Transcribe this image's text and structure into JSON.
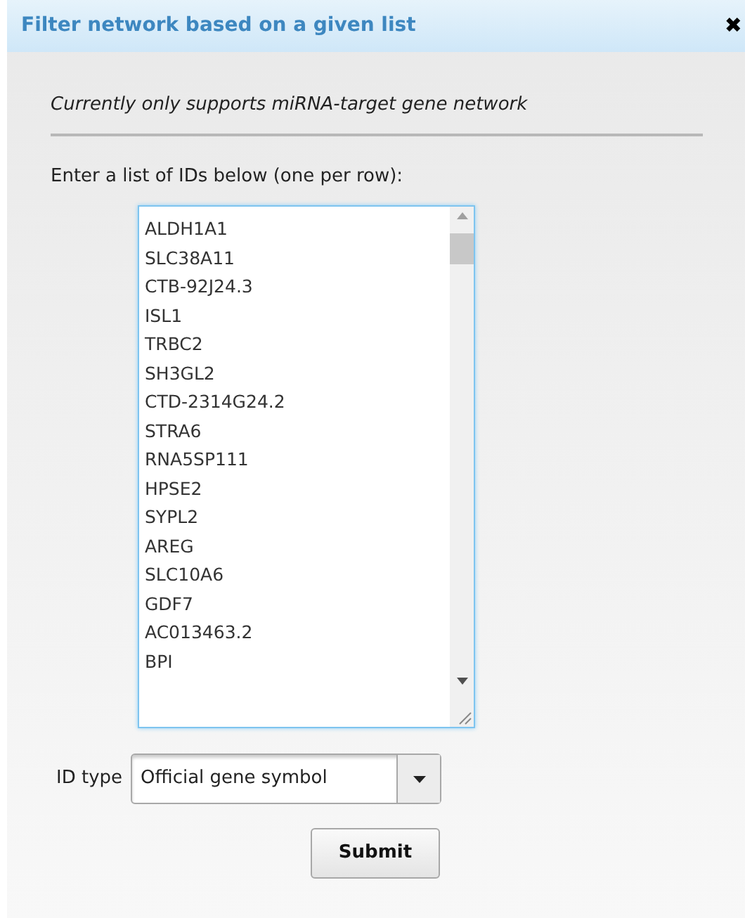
{
  "dialog": {
    "title": "Filter network based on a given list",
    "close": "✖"
  },
  "note": "Currently only supports miRNA-target gene network",
  "list_label": "Enter a list of IDs below (one per row):",
  "ids": [
    "ALDH1A1",
    "SLC38A11",
    "CTB-92J24.3",
    "ISL1",
    "TRBC2",
    "SH3GL2",
    "CTD-2314G24.2",
    "STRA6",
    "RNA5SP111",
    "HPSE2",
    "SYPL2",
    "AREG",
    "SLC10A6",
    "GDF7",
    "AC013463.2",
    "BPI"
  ],
  "id_type": {
    "label": "ID type",
    "value": "Official gene symbol"
  },
  "submit": "Submit"
}
